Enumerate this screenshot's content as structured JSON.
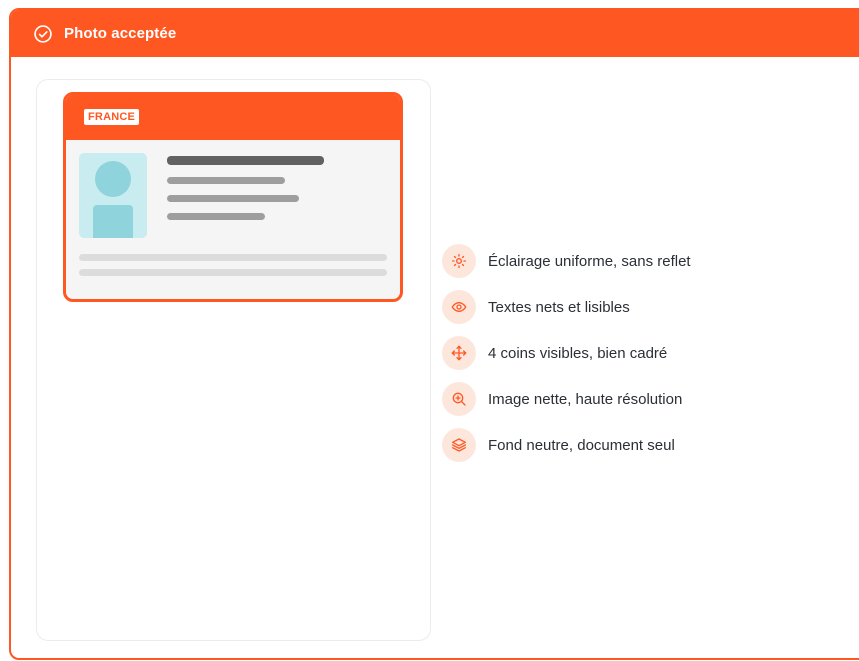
{
  "header": {
    "icon": "check-circle-icon",
    "title": "Photo acceptée"
  },
  "colors": {
    "accent": "#ff5722",
    "icon_bg": "#fde7dc",
    "text": "#2b2f36"
  },
  "id_card": {
    "country": "FRANCE"
  },
  "checklist": [
    {
      "icon": "sun-icon",
      "label": "Éclairage uniforme, sans reflet"
    },
    {
      "icon": "eye-icon",
      "label": "Textes nets et lisibles"
    },
    {
      "icon": "move-arrows-icon",
      "label": "4 coins visibles, bien cadré"
    },
    {
      "icon": "zoom-in-icon",
      "label": "Image nette, haute résolution"
    },
    {
      "icon": "layers-icon",
      "label": "Fond neutre, document seul"
    }
  ]
}
